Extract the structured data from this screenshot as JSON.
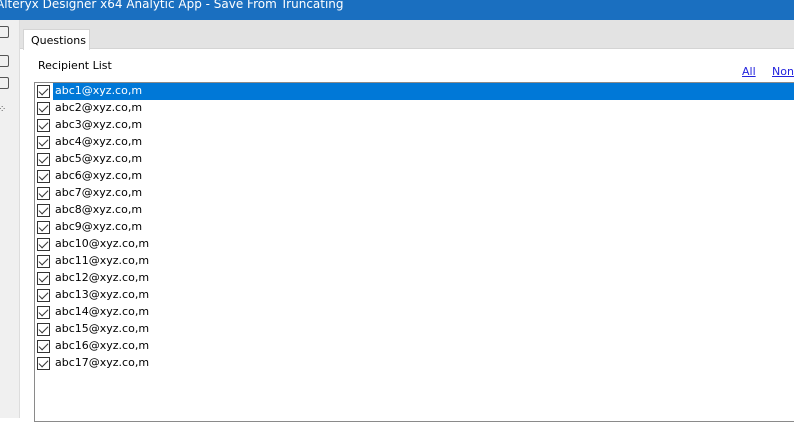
{
  "window": {
    "title": "Alteryx Designer x64 Analytic App - Save From Truncating"
  },
  "tabs": [
    {
      "label": "Questions"
    }
  ],
  "recipient_list": {
    "label": "Recipient List",
    "select_all": "All",
    "select_none": "None",
    "items": [
      {
        "email": "abc1@xyz.co,m",
        "checked": true,
        "selected": true
      },
      {
        "email": "abc2@xyz.co,m",
        "checked": true
      },
      {
        "email": "abc3@xyz.co,m",
        "checked": true
      },
      {
        "email": "abc4@xyz.co,m",
        "checked": true
      },
      {
        "email": "abc5@xyz.co,m",
        "checked": true
      },
      {
        "email": "abc6@xyz.co,m",
        "checked": true
      },
      {
        "email": "abc7@xyz.co,m",
        "checked": true
      },
      {
        "email": "abc8@xyz.co,m",
        "checked": true
      },
      {
        "email": "abc9@xyz.co,m",
        "checked": true
      },
      {
        "email": "abc10@xyz.co,m",
        "checked": true
      },
      {
        "email": "abc11@xyz.co,m",
        "checked": true
      },
      {
        "email": "abc12@xyz.co,m",
        "checked": true
      },
      {
        "email": "abc13@xyz.co,m",
        "checked": true
      },
      {
        "email": "abc14@xyz.co,m",
        "checked": true
      },
      {
        "email": "abc15@xyz.co,m",
        "checked": true
      },
      {
        "email": "abc16@xyz.co,m",
        "checked": true
      },
      {
        "email": "abc17@xyz.co,m",
        "checked": true
      }
    ]
  }
}
